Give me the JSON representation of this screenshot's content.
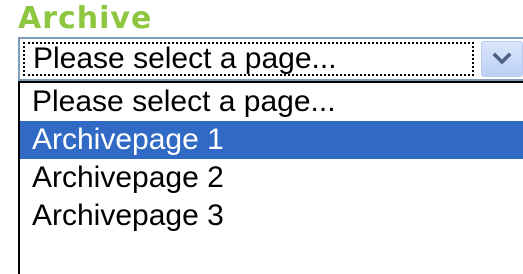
{
  "heading": "Archive",
  "select": {
    "value": "Please select a page...",
    "button_icon": "chevron-down-icon"
  },
  "options": [
    {
      "label": "Please select a page...",
      "selected": false
    },
    {
      "label": "Archivepage 1",
      "selected": true
    },
    {
      "label": "Archivepage 2",
      "selected": false
    },
    {
      "label": "Archivepage 3",
      "selected": false
    }
  ],
  "colors": {
    "heading": "#8dc63f",
    "highlight": "#316ac5",
    "border": "#7f9db9",
    "button": "#c8d8f8"
  }
}
